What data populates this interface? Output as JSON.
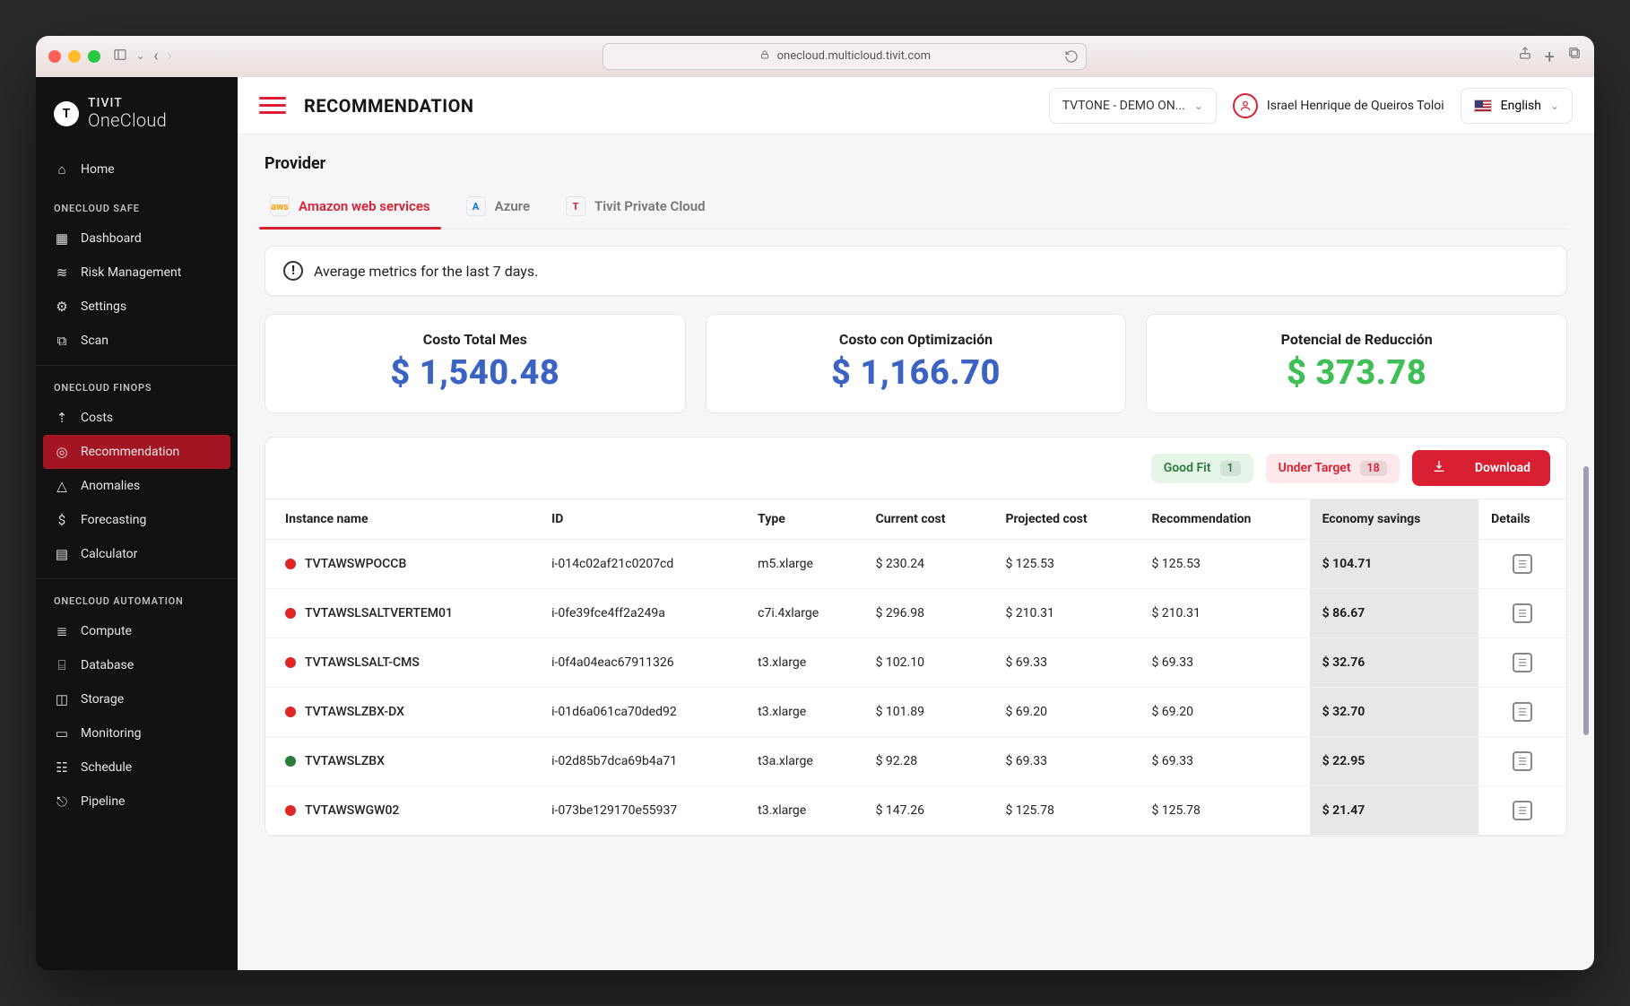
{
  "browser": {
    "url": "onecloud.multicloud.tivit.com"
  },
  "brand": {
    "top": "TIVIT",
    "bottom": "OneCloud"
  },
  "sidebar": {
    "home": "Home",
    "sections": [
      {
        "title": "ONECLOUD SAFE",
        "items": [
          {
            "icon": "dashboard-icon",
            "label": "Dashboard"
          },
          {
            "icon": "risk-icon",
            "label": "Risk Management"
          },
          {
            "icon": "settings-icon",
            "label": "Settings"
          },
          {
            "icon": "scan-icon",
            "label": "Scan"
          }
        ]
      },
      {
        "title": "ONECLOUD FINOPS",
        "items": [
          {
            "icon": "costs-icon",
            "label": "Costs"
          },
          {
            "icon": "recommendation-icon",
            "label": "Recommendation",
            "active": true
          },
          {
            "icon": "anomalies-icon",
            "label": "Anomalies"
          },
          {
            "icon": "forecasting-icon",
            "label": "Forecasting"
          },
          {
            "icon": "calculator-icon",
            "label": "Calculator"
          }
        ]
      },
      {
        "title": "ONECLOUD AUTOMATION",
        "items": [
          {
            "icon": "compute-icon",
            "label": "Compute"
          },
          {
            "icon": "database-icon",
            "label": "Database"
          },
          {
            "icon": "storage-icon",
            "label": "Storage"
          },
          {
            "icon": "monitoring-icon",
            "label": "Monitoring"
          },
          {
            "icon": "schedule-icon",
            "label": "Schedule"
          },
          {
            "icon": "pipeline-icon",
            "label": "Pipeline"
          }
        ]
      }
    ]
  },
  "topbar": {
    "title": "RECOMMENDATION",
    "tenant": "TVTONE - DEMO ON...",
    "user": "Israel Henrique de Queiros Toloi",
    "language": "English"
  },
  "provider": {
    "section_label": "Provider",
    "tabs": [
      {
        "label": "Amazon web services",
        "short": "aws",
        "active": true
      },
      {
        "label": "Azure",
        "short": "A",
        "active": false
      },
      {
        "label": "Tivit Private Cloud",
        "short": "T",
        "active": false
      }
    ]
  },
  "notice": "Average metrics for the last 7 days.",
  "metrics": [
    {
      "title": "Costo Total Mes",
      "value": "$ 1,540.48",
      "color": "blue"
    },
    {
      "title": "Costo con Optimización",
      "value": "$ 1,166.70",
      "color": "blue"
    },
    {
      "title": "Potencial de Reducción",
      "value": "$ 373.78",
      "color": "green"
    }
  ],
  "filters": {
    "good_fit_label": "Good Fit",
    "good_fit_count": "1",
    "under_target_label": "Under Target",
    "under_target_count": "18",
    "download": "Download"
  },
  "table": {
    "columns": {
      "instance": "Instance name",
      "id": "ID",
      "type": "Type",
      "current": "Current cost",
      "projected": "Projected cost",
      "recommendation": "Recommendation",
      "economy": "Economy savings",
      "details": "Details"
    },
    "rows": [
      {
        "status": "red",
        "instance": "TVTAWSWPOCCB",
        "id": "i-014c02af21c0207cd",
        "type": "m5.xlarge",
        "current": "$ 230.24",
        "projected": "$ 125.53",
        "recommendation": "$ 125.53",
        "economy": "$ 104.71"
      },
      {
        "status": "red",
        "instance": "TVTAWSLSALTVERTEM01",
        "id": "i-0fe39fce4ff2a249a",
        "type": "c7i.4xlarge",
        "current": "$ 296.98",
        "projected": "$ 210.31",
        "recommendation": "$ 210.31",
        "economy": "$ 86.67"
      },
      {
        "status": "red",
        "instance": "TVTAWSLSALT-CMS",
        "id": "i-0f4a04eac67911326",
        "type": "t3.xlarge",
        "current": "$ 102.10",
        "projected": "$ 69.33",
        "recommendation": "$ 69.33",
        "economy": "$ 32.76"
      },
      {
        "status": "red",
        "instance": "TVTAWSLZBX-DX",
        "id": "i-01d6a061ca70ded92",
        "type": "t3.xlarge",
        "current": "$ 101.89",
        "projected": "$ 69.20",
        "recommendation": "$ 69.20",
        "economy": "$ 32.70"
      },
      {
        "status": "green",
        "instance": "TVTAWSLZBX",
        "id": "i-02d85b7dca69b4a71",
        "type": "t3a.xlarge",
        "current": "$ 92.28",
        "projected": "$ 69.33",
        "recommendation": "$ 69.33",
        "economy": "$ 22.95"
      },
      {
        "status": "red",
        "instance": "TVTAWSWGW02",
        "id": "i-073be129170e55937",
        "type": "t3.xlarge",
        "current": "$ 147.26",
        "projected": "$ 125.78",
        "recommendation": "$ 125.78",
        "economy": "$ 21.47"
      }
    ]
  }
}
